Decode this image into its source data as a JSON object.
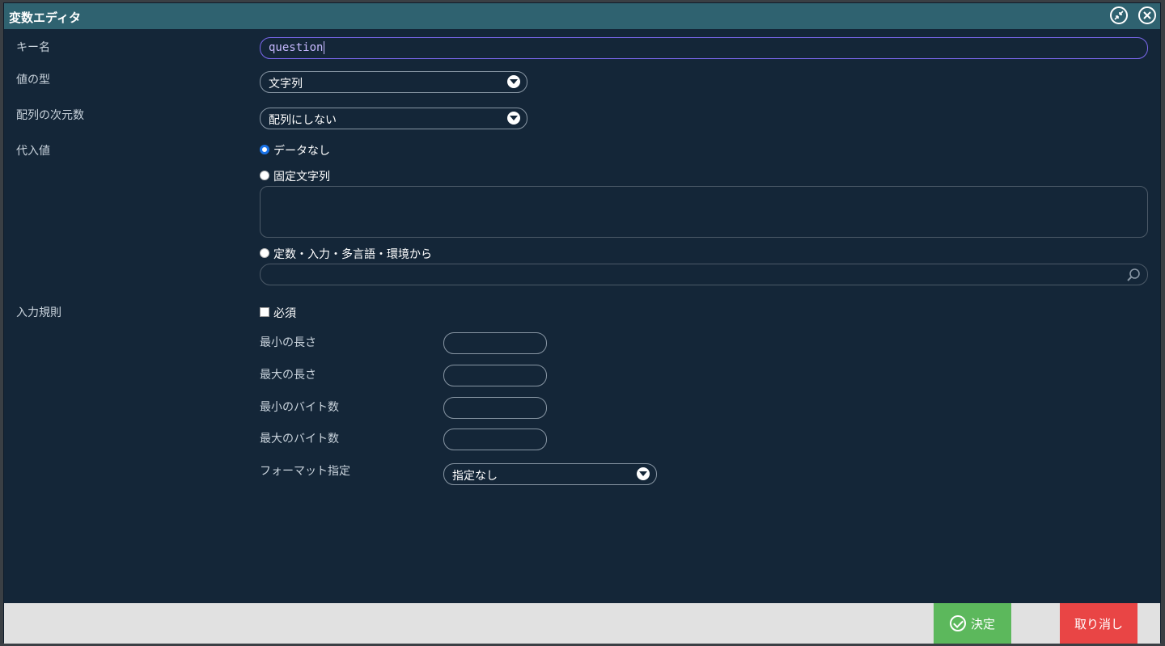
{
  "dialog": {
    "title": "変数エディタ",
    "shrink_icon": "compress-icon",
    "close_icon": "close-icon"
  },
  "form": {
    "key_name_label": "キー名",
    "key_name_value": "question",
    "value_type_label": "値の型",
    "value_type_selected": "文字列",
    "array_dim_label": "配列の次元数",
    "array_dim_selected": "配列にしない",
    "assign_label": "代入値",
    "assign_options": [
      "データなし",
      "固定文字列",
      "定数・入力・多言語・環境から"
    ],
    "assign_selected": "データなし",
    "input_rules_label": "入力規則",
    "required_label": "必須",
    "min_length_label": "最小の長さ",
    "max_length_label": "最大の長さ",
    "min_bytes_label": "最小のバイト数",
    "max_bytes_label": "最大のバイト数",
    "format_label": "フォーマット指定",
    "format_selected": "指定なし"
  },
  "footer": {
    "ok_label": "決定",
    "cancel_label": "取り消し"
  },
  "colors": {
    "titlebar": "#2f6270",
    "dialog_bg": "#142638",
    "ok": "#5cb85c",
    "cancel": "#e94545",
    "input_focus": "#7b68ee"
  }
}
